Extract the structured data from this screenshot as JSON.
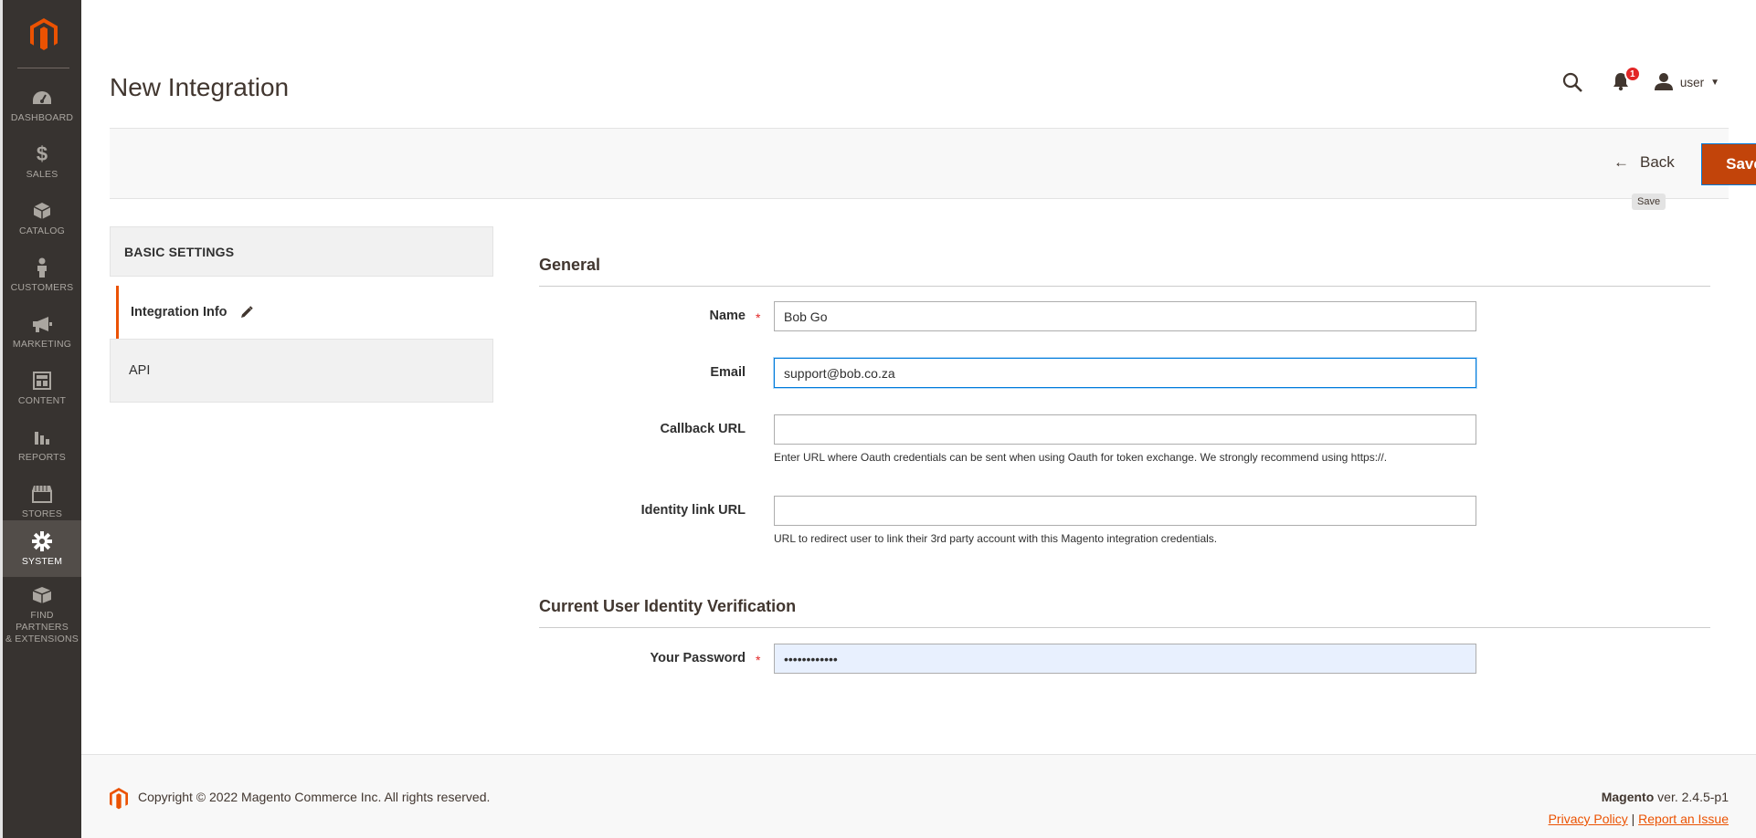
{
  "menu": {
    "items": [
      {
        "label": "DASHBOARD",
        "icon": "dashboard-icon"
      },
      {
        "label": "SALES",
        "icon": "dollar-icon"
      },
      {
        "label": "CATALOG",
        "icon": "box-icon"
      },
      {
        "label": "CUSTOMERS",
        "icon": "person-icon"
      },
      {
        "label": "MARKETING",
        "icon": "megaphone-icon"
      },
      {
        "label": "CONTENT",
        "icon": "layout-icon"
      },
      {
        "label": "REPORTS",
        "icon": "bar-chart-icon"
      },
      {
        "label": "STORES",
        "icon": "storefront-icon"
      },
      {
        "label": "SYSTEM",
        "icon": "gear-icon"
      },
      {
        "label_line1": "FIND PARTNERS",
        "label_line2": "& EXTENSIONS",
        "icon": "blocks-icon"
      }
    ]
  },
  "header": {
    "title": "New Integration",
    "notification_count": "1",
    "user": "user"
  },
  "actions": {
    "back_label": "Back",
    "save_label": "Save",
    "save_tooltip": "Save"
  },
  "tabs": {
    "title": "BASIC SETTINGS",
    "items": [
      {
        "label": "Integration Info"
      },
      {
        "label": "API"
      }
    ]
  },
  "form": {
    "general_title": "General",
    "name": {
      "label": "Name",
      "value": "Bob Go"
    },
    "email": {
      "label": "Email",
      "value": "support@bob.co.za"
    },
    "callback": {
      "label": "Callback URL",
      "value": "",
      "note": "Enter URL where Oauth credentials can be sent when using Oauth for token exchange. We strongly recommend using https://."
    },
    "identity": {
      "label": "Identity link URL",
      "value": "",
      "note": "URL to redirect user to link their 3rd party account with this Magento integration credentials."
    },
    "verification_title": "Current User Identity Verification",
    "password": {
      "label": "Your Password",
      "value": "••••••••••••"
    },
    "required_mark": "*"
  },
  "footer": {
    "copyright": "Copyright © 2022 Magento Commerce Inc. All rights reserved.",
    "brand": "Magento",
    "version": " ver. 2.4.5-p1",
    "privacy": "Privacy Policy",
    "separator": " | ",
    "report": "Report an Issue"
  },
  "colors": {
    "accent": "#eb5202",
    "save": "#c2440a",
    "menu_bg": "#373330"
  }
}
